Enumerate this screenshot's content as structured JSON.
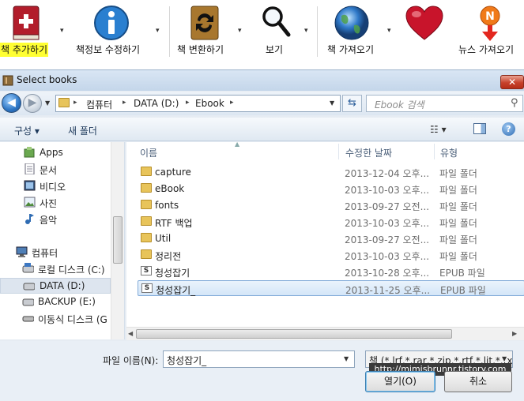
{
  "toolbar": {
    "add_book": "책 추가하기",
    "edit_meta": "책정보 수정하기",
    "convert": "책 변환하기",
    "view": "보기",
    "get_books": "책 가져오기",
    "fetch_news": "뉴스 가져오기",
    "arrow": "▾",
    "icons": [
      "book-add-icon",
      "info-icon",
      "convert-icon",
      "magnifier-icon",
      "globe-icon",
      "heart-icon",
      "news-icon"
    ]
  },
  "dialog": {
    "title": "Select books",
    "close": "✕",
    "address": [
      "컴퓨터",
      "DATA (D:)",
      "Ebook"
    ],
    "crumb_sep": "▸",
    "search_placeholder": "Ebook 검색",
    "organize": "구성 ▾",
    "new_folder": "새 폴더",
    "view_toggle": "☷ ▾",
    "help": "?",
    "nav": [
      {
        "label": "Apps",
        "icon": "apps-icon"
      },
      {
        "label": "문서",
        "icon": "document-icon"
      },
      {
        "label": "비디오",
        "icon": "video-icon"
      },
      {
        "label": "사진",
        "icon": "picture-icon"
      },
      {
        "label": "음악",
        "icon": "music-icon"
      },
      {
        "label": "컴퓨터",
        "icon": "computer-icon"
      },
      {
        "label": "로컬 디스크 (C:)",
        "icon": "drive-icon"
      },
      {
        "label": "DATA (D:)",
        "icon": "drive-icon"
      },
      {
        "label": "BACKUP (E:)",
        "icon": "drive-icon"
      },
      {
        "label": "이동식 디스크 (G",
        "icon": "removable-drive-icon"
      }
    ],
    "columns": [
      "이름",
      "수정한 날짜",
      "유형"
    ],
    "files": [
      {
        "name": "capture",
        "date": "2013-12-04 오후...",
        "type": "파일 폴더",
        "kind": "folder"
      },
      {
        "name": "eBook",
        "date": "2013-10-03 오후...",
        "type": "파일 폴더",
        "kind": "folder"
      },
      {
        "name": "fonts",
        "date": "2013-09-27 오전...",
        "type": "파일 폴더",
        "kind": "folder"
      },
      {
        "name": "RTF 백업",
        "date": "2013-10-03 오후...",
        "type": "파일 폴더",
        "kind": "folder"
      },
      {
        "name": "Util",
        "date": "2013-09-27 오전...",
        "type": "파일 폴더",
        "kind": "folder"
      },
      {
        "name": "정리전",
        "date": "2013-10-03 오후...",
        "type": "파일 폴더",
        "kind": "folder"
      },
      {
        "name": "청성잡기",
        "date": "2013-10-28 오후...",
        "type": "EPUB 파일",
        "kind": "epub"
      },
      {
        "name": "청성잡기_",
        "date": "2013-11-25 오후...",
        "type": "EPUB 파일",
        "kind": "epub"
      }
    ],
    "filename_label": "파일 이름(N):",
    "filename_value": "청성잡기_",
    "filetype_value": "책 (*.lrf,*.rar,*.zip,*.rtf,*.lit,*.txt",
    "watermark": "http://mimisbrunnr.tistory.com",
    "open": "열기(O)",
    "cancel": "취소"
  }
}
